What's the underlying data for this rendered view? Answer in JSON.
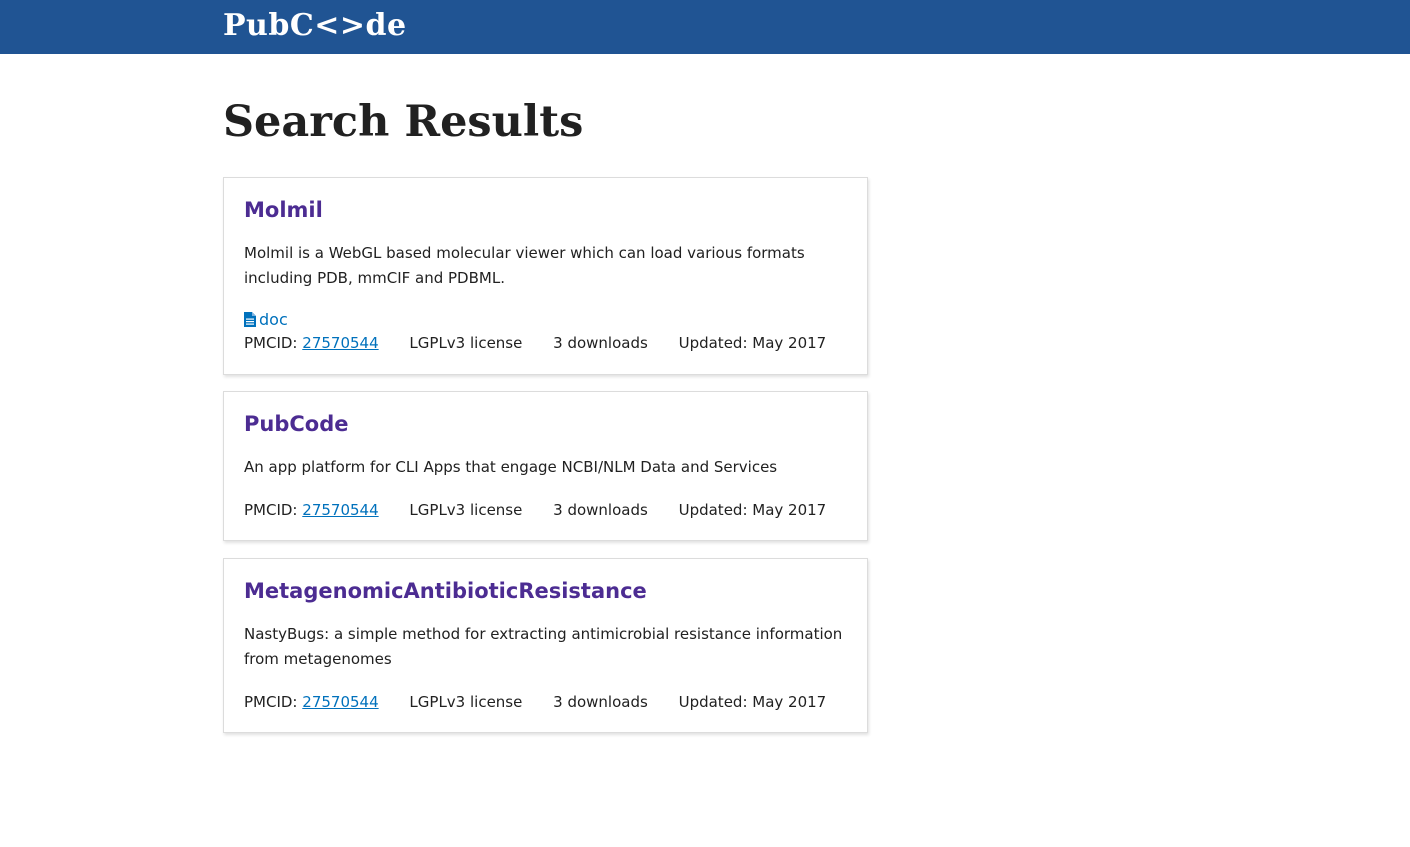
{
  "header": {
    "logo": "PubC<>de",
    "color": "#205493"
  },
  "page": {
    "title": "Search Results"
  },
  "results": [
    {
      "title": "Molmil",
      "description": "Molmil is a WebGL based molecular viewer which can load various formats including PDB, mmCIF and PDBML.",
      "doc_label": "doc",
      "pmcid_label": "PMCID:",
      "pmcid": "27570544",
      "license": "LGPLv3 license",
      "downloads": "3 downloads",
      "updated": "Updated: May 2017"
    },
    {
      "title": "PubCode",
      "description": "An app platform for CLI Apps that engage NCBI/NLM Data and Services",
      "pmcid_label": "PMCID:",
      "pmcid": "27570544",
      "license": "LGPLv3 license",
      "downloads": "3 downloads",
      "updated": "Updated: May 2017"
    },
    {
      "title": "MetagenomicAntibioticResistance",
      "description": "NastyBugs: a simple method for extracting antimicrobial resistance information from metagenomes",
      "pmcid_label": "PMCID:",
      "pmcid": "27570544",
      "license": "LGPLv3 license",
      "downloads": "3 downloads",
      "updated": "Updated: May 2017"
    }
  ],
  "colors": {
    "title_link": "#4c2c92",
    "link": "#0071bc"
  },
  "icons": {
    "doc": "document-icon"
  }
}
